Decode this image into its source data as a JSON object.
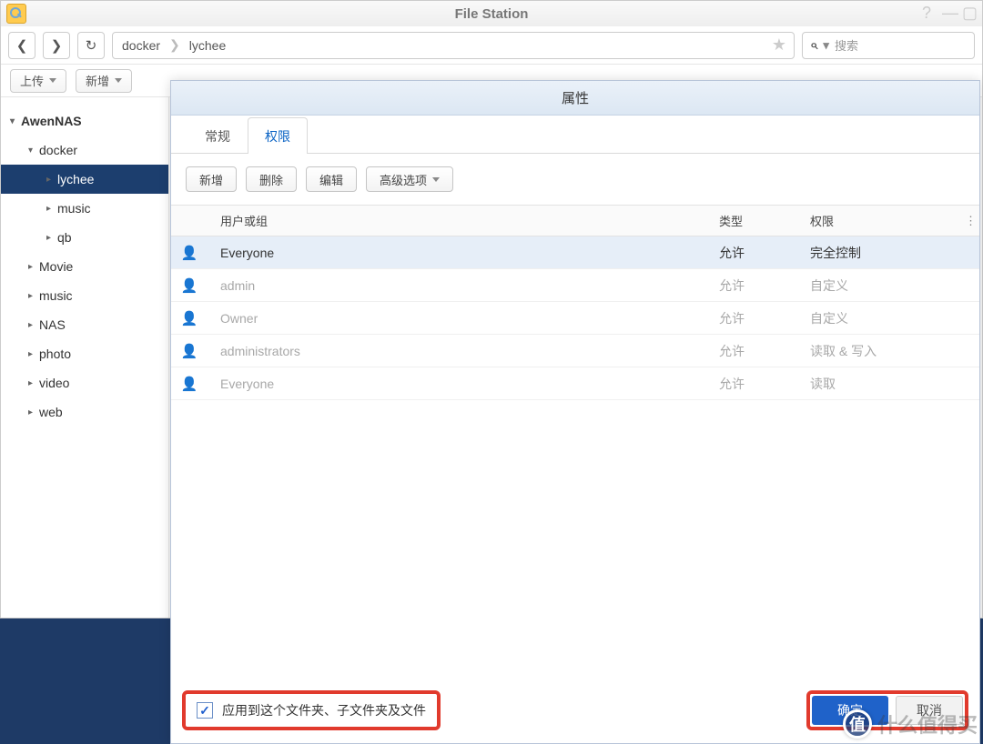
{
  "window": {
    "title": "File Station",
    "breadcrumb": [
      "docker",
      "lychee"
    ],
    "search_placeholder": "搜索"
  },
  "toolbar": {
    "upload": "上传",
    "new": "新增"
  },
  "tree": {
    "root": "AwenNAS",
    "items": [
      {
        "label": "docker",
        "level": 1,
        "open": true
      },
      {
        "label": "lychee",
        "level": 2,
        "open": false,
        "selected": true
      },
      {
        "label": "music",
        "level": 2,
        "open": false
      },
      {
        "label": "qb",
        "level": 2,
        "open": false
      },
      {
        "label": "Movie",
        "level": 1,
        "open": false
      },
      {
        "label": "music",
        "level": 1,
        "open": false
      },
      {
        "label": "NAS",
        "level": 1,
        "open": false
      },
      {
        "label": "photo",
        "level": 1,
        "open": false
      },
      {
        "label": "video",
        "level": 1,
        "open": false
      },
      {
        "label": "web",
        "level": 1,
        "open": false
      }
    ]
  },
  "modal": {
    "title": "属性",
    "tabs": {
      "general": "常规",
      "permission": "权限"
    },
    "buttons": {
      "add": "新增",
      "delete": "删除",
      "edit": "编辑",
      "advanced": "高级选项"
    },
    "columns": {
      "user": "用户或组",
      "type": "类型",
      "perm": "权限"
    },
    "rows": [
      {
        "user": "Everyone",
        "type": "允许",
        "perm": "完全控制",
        "active": true
      },
      {
        "user": "admin",
        "type": "允许",
        "perm": "自定义",
        "active": false
      },
      {
        "user": "Owner",
        "type": "允许",
        "perm": "自定义",
        "active": false
      },
      {
        "user": "administrators",
        "type": "允许",
        "perm": "读取 & 写入",
        "active": false
      },
      {
        "user": "Everyone",
        "type": "允许",
        "perm": "读取",
        "active": false
      }
    ],
    "apply_checkbox": "应用到这个文件夹、子文件夹及文件",
    "ok": "确定",
    "cancel": "取消"
  },
  "watermark": {
    "badge": "值",
    "text": "什么值得买"
  }
}
